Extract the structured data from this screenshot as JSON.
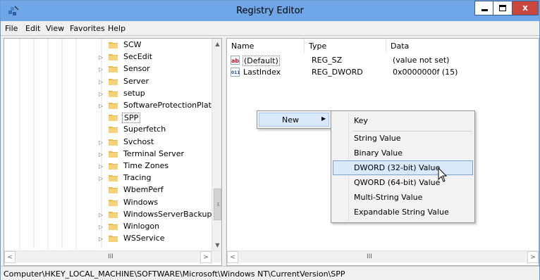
{
  "window": {
    "title": "Registry Editor",
    "close_glyph": "x"
  },
  "menu": [
    "File",
    "Edit",
    "View",
    "Favorites",
    "Help"
  ],
  "tree": {
    "items": [
      {
        "label": "SCW",
        "expandable": false,
        "selected": false
      },
      {
        "label": "SecEdit",
        "expandable": true,
        "selected": false
      },
      {
        "label": "Sensor",
        "expandable": true,
        "selected": false
      },
      {
        "label": "Server",
        "expandable": true,
        "selected": false
      },
      {
        "label": "setup",
        "expandable": true,
        "selected": false
      },
      {
        "label": "SoftwareProtectionPlatfor",
        "expandable": true,
        "selected": false
      },
      {
        "label": "SPP",
        "expandable": false,
        "selected": true
      },
      {
        "label": "Superfetch",
        "expandable": false,
        "selected": false
      },
      {
        "label": "Svchost",
        "expandable": true,
        "selected": false
      },
      {
        "label": "Terminal Server",
        "expandable": true,
        "selected": false
      },
      {
        "label": "Time Zones",
        "expandable": true,
        "selected": false
      },
      {
        "label": "Tracing",
        "expandable": true,
        "selected": false
      },
      {
        "label": "WbemPerf",
        "expandable": false,
        "selected": false
      },
      {
        "label": "Windows",
        "expandable": false,
        "selected": false
      },
      {
        "label": "WindowsServerBackup",
        "expandable": true,
        "selected": false
      },
      {
        "label": "Winlogon",
        "expandable": true,
        "selected": false
      },
      {
        "label": "WSService",
        "expandable": true,
        "selected": false
      }
    ],
    "hscroll_grip": "III"
  },
  "list": {
    "columns": [
      "Name",
      "Type",
      "Data"
    ],
    "rows": [
      {
        "name": "(Default)",
        "type": "REG_SZ",
        "data": "(value not set)",
        "icon": "ab"
      },
      {
        "name": "LastIndex",
        "type": "REG_DWORD",
        "data": "0x0000000f (15)",
        "icon": "011"
      }
    ],
    "hscroll_grip": "III"
  },
  "context_menu": {
    "new_label": "New",
    "submenu": [
      "Key",
      "String Value",
      "Binary Value",
      "DWORD (32-bit) Value",
      "QWORD (64-bit) Value",
      "Multi-String Value",
      "Expandable String Value"
    ],
    "highlighted": "DWORD (32-bit) Value"
  },
  "status": {
    "path": "Computer\\HKEY_LOCAL_MACHINE\\SOFTWARE\\Microsoft\\Windows NT\\CurrentVersion\\SPP"
  },
  "colors": {
    "titlebar": "#6fa6e8",
    "close": "#c9463d",
    "highlight": "#d9e8fb"
  }
}
